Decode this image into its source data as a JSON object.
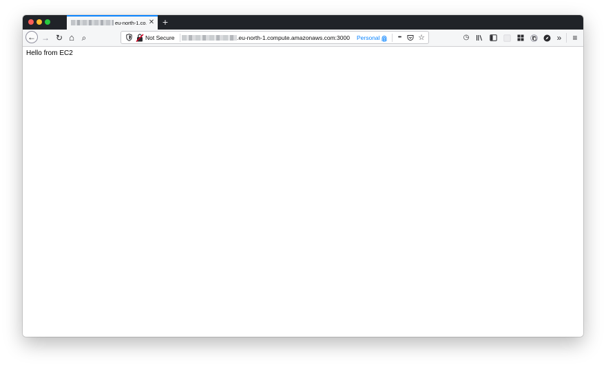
{
  "colors": {
    "tabbar_bg": "#202328",
    "toolbar_bg": "#f5f6f7",
    "accent": "#0a84ff",
    "close_red": "#fd5f57",
    "minimize_yellow": "#febc2e",
    "zoom_green": "#28c840"
  },
  "tab": {
    "title": "eu-north-1.co…",
    "close_glyph": "✕"
  },
  "newtab": {
    "glyph": "+"
  },
  "nav": {
    "back_glyph": "←",
    "forward_glyph": "→",
    "reload_glyph": "↻",
    "home_glyph": "⌂",
    "search_glyph": "⌕"
  },
  "urlbar": {
    "not_secure": "Not Secure",
    "url_visible": ".eu-north-1.compute.amazonaws.com:3000",
    "container": "Personal",
    "menu_glyph": "•••",
    "pocket_glyph": "⬡",
    "bookmark_glyph": "☆"
  },
  "toolbar": {
    "history_glyph": "◷",
    "library_glyph": "⫼",
    "sidebar_glyph": "◫",
    "overflow_glyph": "»",
    "menu_glyph": "≡"
  },
  "icons": [
    "shield-icon",
    "lock-icon",
    "fingerprint-icon",
    "history-icon",
    "library-icon",
    "sidebar-icon",
    "extension-icon",
    "grid-icon",
    "copy-icon",
    "compass-icon"
  ],
  "page": {
    "text": "Hello from EC2"
  }
}
